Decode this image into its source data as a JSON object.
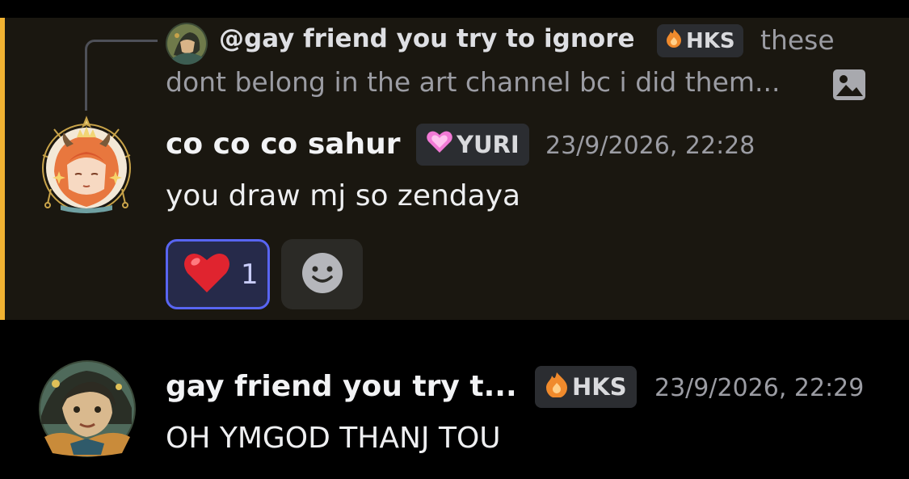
{
  "reply": {
    "author": "@gay friend you try to ignore",
    "tag": "HKS",
    "text_line1": "these",
    "text_line2": "dont belong in the art channel bc i did them...",
    "attachment_icon": "image-icon"
  },
  "message1": {
    "author": "co co co sahur",
    "tag": "YURI",
    "timestamp": "23/9/2026, 22:28",
    "content": "you draw mj so zendaya",
    "reaction": {
      "emoji": "heart",
      "count": "1"
    },
    "add_reaction_icon": "smile-icon"
  },
  "message2": {
    "author": "gay friend you try t...",
    "tag": "HKS",
    "timestamp": "23/9/2026, 22:29",
    "content": "OH YMGOD THANJ TOU"
  },
  "colors": {
    "highlight_bar": "#f0b232",
    "highlight_bg": "#1a1710",
    "reaction_border": "#5865f2",
    "background": "#000000"
  }
}
